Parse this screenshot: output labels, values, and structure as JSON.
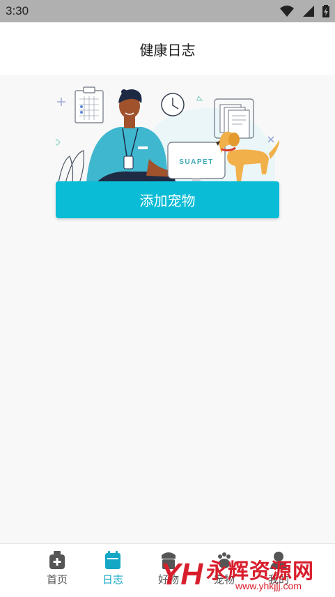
{
  "status_bar": {
    "time": "3:30",
    "icons": [
      "wifi-icon",
      "signal-icon",
      "battery-charging-icon"
    ]
  },
  "header": {
    "title": "健康日志"
  },
  "illustration": {
    "monitor_brand": "SUAPET"
  },
  "main": {
    "add_pet_label": "添加宠物"
  },
  "tabbar": {
    "active_index": 1,
    "active_color": "#13a7c5",
    "items": [
      {
        "label": "首页",
        "icon": "medical-kit-icon"
      },
      {
        "label": "日志",
        "icon": "calendar-icon"
      },
      {
        "label": "好物",
        "icon": "shop-icon"
      },
      {
        "label": "宠物",
        "icon": "paw-icon"
      },
      {
        "label": "我的",
        "icon": "user-icon"
      }
    ]
  },
  "watermark": {
    "logo_text": "YH",
    "text": "永辉资源网",
    "url": "www.yhkjjj.com"
  },
  "colors": {
    "accent": "#0bbcd6",
    "background": "#f8f8f8",
    "watermark": "#d81e2c"
  }
}
